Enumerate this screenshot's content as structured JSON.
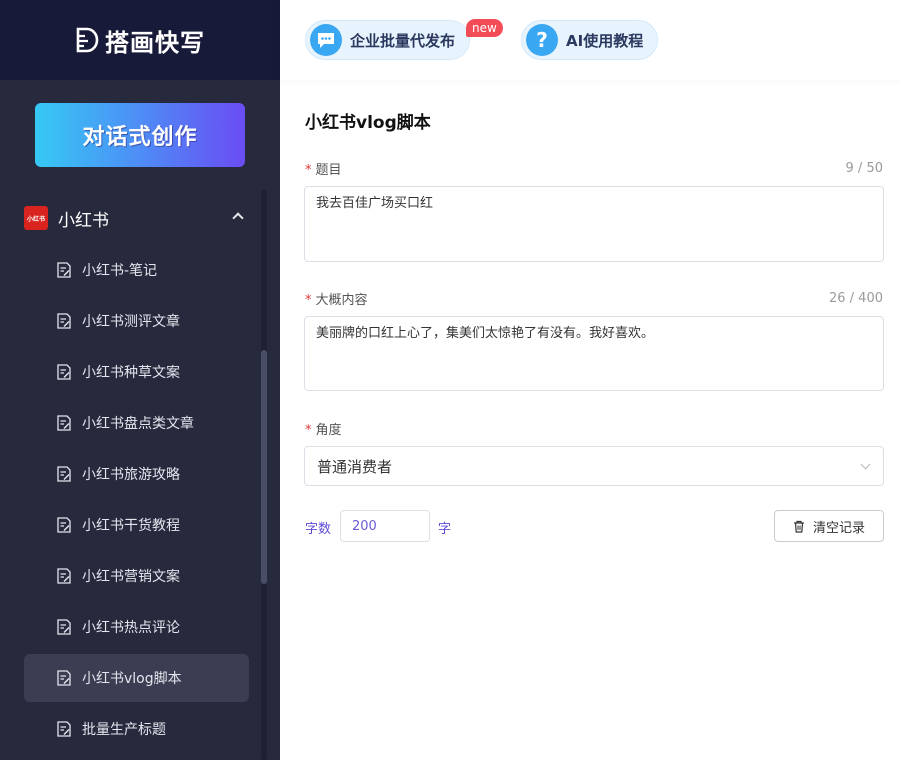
{
  "app": {
    "name": "搭画快写"
  },
  "sidebar": {
    "create_button": "对话式创作",
    "group": {
      "badge": "小红书",
      "label": "小红书"
    },
    "items": [
      {
        "label": "小红书-笔记",
        "icon": "document-icon"
      },
      {
        "label": "小红书测评文章",
        "icon": "document-icon"
      },
      {
        "label": "小红书种草文案",
        "icon": "document-icon"
      },
      {
        "label": "小红书盘点类文章",
        "icon": "document-icon"
      },
      {
        "label": "小红书旅游攻略",
        "icon": "document-icon"
      },
      {
        "label": "小红书干货教程",
        "icon": "document-icon"
      },
      {
        "label": "小红书营销文案",
        "icon": "document-icon"
      },
      {
        "label": "小红书热点评论",
        "icon": "document-icon"
      },
      {
        "label": "小红书vlog脚本",
        "icon": "document-icon",
        "active": true
      },
      {
        "label": "批量生产标题",
        "icon": "document-icon"
      }
    ]
  },
  "topbar": {
    "enterprise_button": "企业批量代发布",
    "new_badge": "new",
    "tutorial_button": "AI使用教程"
  },
  "form": {
    "title": "小红书vlog脚本",
    "topic": {
      "label": "题目",
      "value": "我去百佳广场买口红",
      "counter": "9 / 50"
    },
    "content": {
      "label": "大概内容",
      "value": "美丽牌的口红上心了，集美们太惊艳了有没有。我好喜欢。",
      "counter": "26 / 400"
    },
    "angle": {
      "label": "角度",
      "value": "普通消费者"
    },
    "word_count": {
      "label": "字数",
      "value": "200",
      "unit": "字"
    },
    "clear_button": "清空记录"
  },
  "colors": {
    "sidebar_bg": "#272a3d",
    "logo_bg": "#181a3a",
    "accent_purple": "#5c4bd6",
    "required": "#e3373a",
    "badge_red": "#f24d57"
  }
}
